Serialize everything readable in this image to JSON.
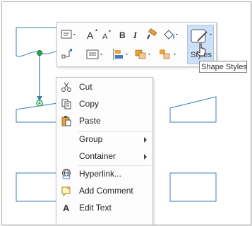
{
  "toolbar": {
    "styles_label": "Styles",
    "icons": [
      "text-style-icon",
      "grow-font-icon",
      "shrink-font-icon",
      "bold-icon",
      "italic-icon",
      "format-painter-icon",
      "fill-icon",
      "styles-icon",
      "connector-icon",
      "align-icon",
      "position-icon",
      "arrange-icon",
      "group-icon"
    ]
  },
  "tooltip": {
    "text": "Shape Styles"
  },
  "menu": {
    "items": [
      {
        "label": "Cut",
        "icon": "scissors-icon"
      },
      {
        "label": "Copy",
        "icon": "copy-icon"
      },
      {
        "label": "Paste",
        "icon": "paste-icon"
      },
      {
        "label": "Group",
        "submenu": true
      },
      {
        "label": "Container",
        "submenu": true
      },
      {
        "label": "Hyperlink...",
        "icon": "hyperlink-icon"
      },
      {
        "label": "Add Comment",
        "icon": "comment-icon"
      },
      {
        "label": "Edit Text",
        "icon": "text-icon"
      }
    ]
  },
  "colors": {
    "shape_stroke": "#3c7ebf",
    "connector": "#3c7ebf",
    "selection_handle": "#2da44e",
    "highlight": "#cde0f7"
  }
}
